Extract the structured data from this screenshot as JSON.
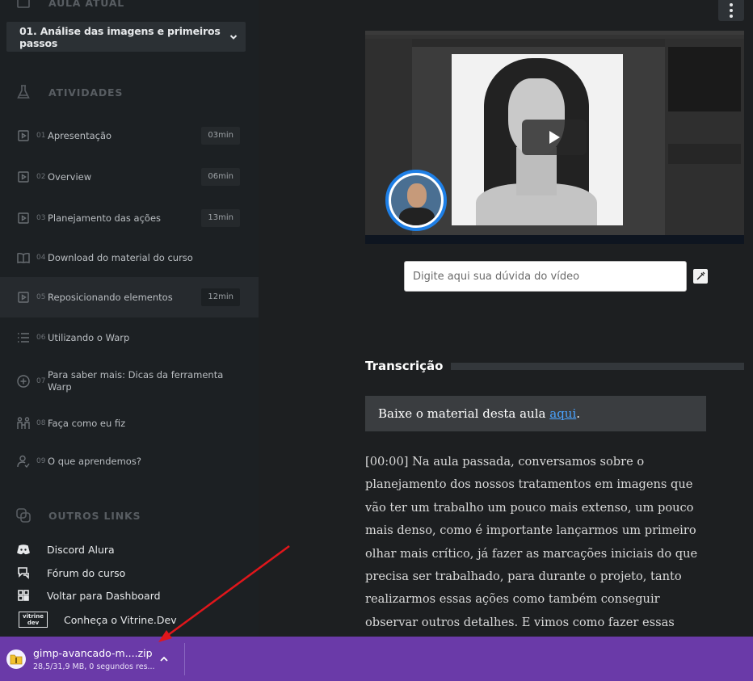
{
  "sidebar": {
    "current_lesson_header": "AULA ATUAL",
    "current_lesson": "01. Análise das imagens e primeiros passos",
    "activities_header": "ATIVIDADES",
    "activities": [
      {
        "num": "01",
        "label": "Apresentação",
        "duration": "03min",
        "icon": "video-icon"
      },
      {
        "num": "02",
        "label": "Overview",
        "duration": "06min",
        "icon": "video-icon"
      },
      {
        "num": "03",
        "label": "Planejamento das ações",
        "duration": "13min",
        "icon": "video-icon"
      },
      {
        "num": "04",
        "label": "Download do material do curso",
        "duration": "",
        "icon": "book-icon"
      },
      {
        "num": "05",
        "label": "Reposicionando elementos",
        "duration": "12min",
        "icon": "video-icon"
      },
      {
        "num": "06",
        "label": "Utilizando o Warp",
        "duration": "",
        "icon": "list-icon"
      },
      {
        "num": "07",
        "label": "Para saber mais: Dicas da ferramenta Warp",
        "duration": "",
        "icon": "plus-circle-icon"
      },
      {
        "num": "08",
        "label": "Faça como eu fiz",
        "duration": "",
        "icon": "people-icon"
      },
      {
        "num": "09",
        "label": "O que aprendemos?",
        "duration": "",
        "icon": "person-check-icon"
      }
    ],
    "other_links_header": "OUTROS LINKS",
    "other_links": [
      {
        "label": "Discord Alura",
        "icon": "discord-icon"
      },
      {
        "label": "Fórum do curso",
        "icon": "forum-icon"
      },
      {
        "label": "Voltar para Dashboard",
        "icon": "dashboard-icon"
      },
      {
        "label": "Conheça o Vitrine.Dev",
        "icon": "vitrine-dev-logo"
      }
    ],
    "vitrine_logo_text": "vitrine dev"
  },
  "main": {
    "question_placeholder": "Digite aqui sua dúvida do vídeo",
    "transcription_title": "Transcrição",
    "material_prefix": "Baixe o material desta aula ",
    "material_link": "aqui",
    "material_suffix": ".",
    "transcript_text": "[00:00] Na aula passada, conversamos sobre o planejamento dos nossos tratamentos em imagens que vão ter um trabalho um pouco mais extenso, um pouco mais denso, como é importante lançarmos um primeiro olhar mais crítico, já fazer as marcações iniciais do que precisa ser trabalhado, para durante o projeto, tanto realizarmos essas ações como também conseguir observar outros detalhes. E vimos como fazer essas marcações de"
  },
  "download": {
    "filename": "gimp-avancado-m....zip",
    "status": "28,5/31,9 MB, 0 segundos res..."
  },
  "colors": {
    "download_bar": "#6a3aa8",
    "link": "#4aa3ff",
    "arrow": "#e0161b",
    "avatar_ring": "#1e7fe6"
  }
}
